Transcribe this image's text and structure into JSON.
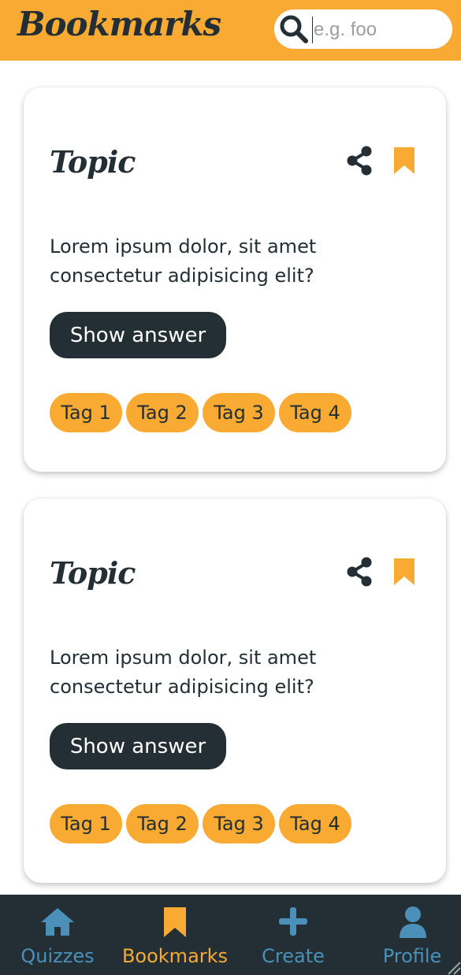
{
  "header": {
    "title": "Bookmarks",
    "search_placeholder": "e.g. foo",
    "search_value": ""
  },
  "colors": {
    "accent": "#f9aa33",
    "dark": "#232f34",
    "nav_inactive": "#4a90b8"
  },
  "cards": [
    {
      "topic": "Topic",
      "question": "Lorem ipsum dolor, sit amet consectetur adipisicing elit?",
      "button_label": "Show answer",
      "tags": [
        "Tag 1",
        "Tag 2",
        "Tag 3",
        "Tag 4"
      ]
    },
    {
      "topic": "Topic",
      "question": "Lorem ipsum dolor, sit amet consectetur adipisicing elit?",
      "button_label": "Show answer",
      "tags": [
        "Tag 1",
        "Tag 2",
        "Tag 3",
        "Tag 4"
      ]
    }
  ],
  "nav": {
    "items": [
      {
        "label": "Quizzes",
        "icon": "home-icon",
        "active": false
      },
      {
        "label": "Bookmarks",
        "icon": "bookmark-icon",
        "active": true
      },
      {
        "label": "Create",
        "icon": "plus-icon",
        "active": false
      },
      {
        "label": "Profile",
        "icon": "user-icon",
        "active": false
      }
    ]
  }
}
